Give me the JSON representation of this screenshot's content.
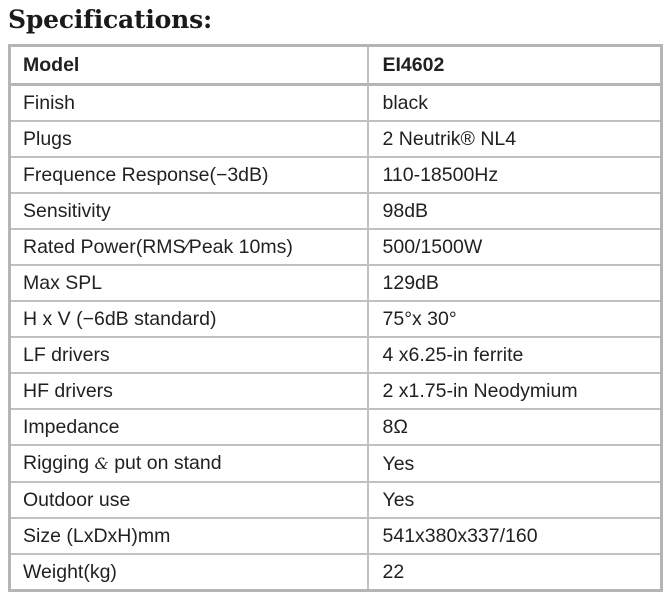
{
  "document": {
    "title": "Specifications:"
  },
  "table": {
    "columns": [
      "Model",
      "EI4602"
    ],
    "header": {
      "label": "Model",
      "value": "EI4602"
    },
    "rows": [
      {
        "label": "Finish",
        "value": "black"
      },
      {
        "label": "Plugs",
        "value": "2 Neutrik® NL4"
      },
      {
        "label": "Frequence Response(−3dB)",
        "value": "110-18500Hz"
      },
      {
        "label": "Sensitivity",
        "value": "98dB"
      },
      {
        "label": "Rated Power(RMS∕Peak 10ms)",
        "value": "500/1500W"
      },
      {
        "label": "Max SPL",
        "value": "129dB"
      },
      {
        "label": "H x V (−6dB standard)",
        "value": "75°x 30°"
      },
      {
        "label": "LF drivers",
        "value": "4 x6.25-in ferrite"
      },
      {
        "label": "HF drivers",
        "value": "2 x1.75-in Neodymium"
      },
      {
        "label": "Impedance",
        "value": "8Ω"
      },
      {
        "label": "Rigging & put on stand",
        "value": "Yes"
      },
      {
        "label": "Outdoor use",
        "value": "Yes"
      },
      {
        "label": "Size (LxDxH)mm",
        "value": "541x380x337/160"
      },
      {
        "label": "Weight(kg)",
        "value": "22"
      }
    ]
  },
  "colors": {
    "text": "#231f20",
    "border": "#c0c0c0",
    "border_strong": "#b5b5b5",
    "background": "#ffffff"
  }
}
